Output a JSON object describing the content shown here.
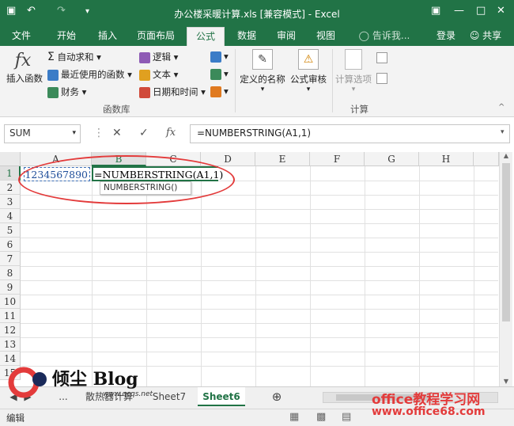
{
  "titlebar": {
    "title": "办公楼采暖计算.xls  [兼容模式] - Excel"
  },
  "tabs": [
    "文件",
    "开始",
    "插入",
    "页面布局",
    "公式",
    "数据",
    "审阅",
    "视图"
  ],
  "tell_me": "告诉我...",
  "login": "登录",
  "share": "共享",
  "ribbon": {
    "insert_function": "插入函数",
    "autosum": "自动求和",
    "recent": "最近使用的函数",
    "financial": "财务",
    "logical": "逻辑",
    "text": "文本",
    "datetime": "日期和时间",
    "group_funclib": "函数库",
    "defined_names": "定义的名称",
    "formula_audit": "公式审核",
    "calc_options": "计算选项",
    "group_calc": "计算",
    "fx_symbol": "fx"
  },
  "namebox": "SUM",
  "formula": "=NUMBERSTRING(A1,1)",
  "columns": [
    "A",
    "B",
    "C",
    "D",
    "E",
    "F",
    "G",
    "H"
  ],
  "rows": [
    "1",
    "2",
    "3",
    "4",
    "5",
    "6",
    "7",
    "8",
    "9",
    "10",
    "11",
    "12",
    "13",
    "14",
    "15"
  ],
  "cells": {
    "A1": "1234567890",
    "B1": "=NUMBERSTRING(A1,1)"
  },
  "tooltip": "NUMBERSTRING()",
  "sheets": [
    "...",
    "散热器计算",
    "Sheet7",
    "Sheet6"
  ],
  "status": "编辑",
  "watermark": {
    "blog": "倾尘 Blog",
    "blog_url": "www.qcqs.net",
    "site": "office教程学习网",
    "site_url": "www.office68.com"
  }
}
